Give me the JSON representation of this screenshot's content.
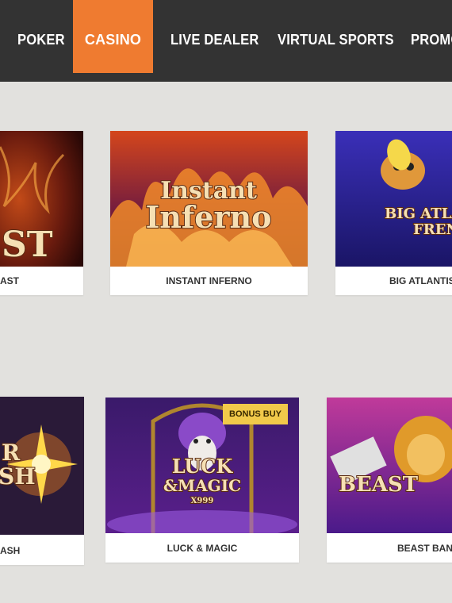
{
  "nav": {
    "items": [
      "POKER",
      "CASINO",
      "LIVE DEALER",
      "VIRTUAL SPORTS",
      "PROMO"
    ],
    "active": "CASINO"
  },
  "colors": {
    "nav_bg": "#333333",
    "active_tab": "#ef7b30",
    "page_bg": "#e2e1de",
    "badge": "#f1c94a"
  },
  "games": {
    "row1": [
      {
        "title": "AST",
        "art_text": [
          "ST"
        ]
      },
      {
        "title": "INSTANT INFERNO",
        "art_text": [
          "Instant",
          "Inferno"
        ]
      },
      {
        "title": "BIG ATLANTIS F",
        "art_text": [
          "BIG ATLA",
          "FREN"
        ]
      }
    ],
    "row2": [
      {
        "title": "ASH",
        "art_text": [
          "R",
          "SH"
        ]
      },
      {
        "title": "LUCK & MAGIC",
        "art_text": [
          "LUCK",
          "&MAGIC",
          "X999"
        ],
        "badge": "BONUS BUY"
      },
      {
        "title": "BEAST BAND",
        "art_text": [
          "BEAST"
        ]
      }
    ]
  }
}
